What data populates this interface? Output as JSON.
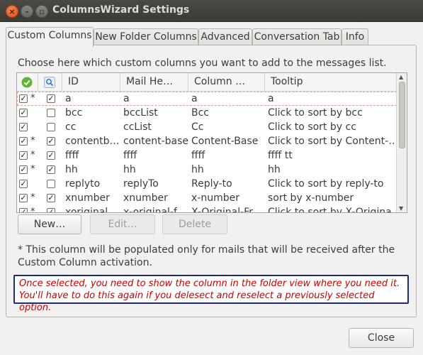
{
  "window": {
    "title": "ColumnsWizard Settings"
  },
  "tabs": [
    "Custom Columns",
    "New Folder Columns",
    "Advanced",
    "Conversation Tab",
    "Info"
  ],
  "intro": "Choose here which custom columns you want to add to the messages list.",
  "table": {
    "headers": {
      "enabled_icon": "check-circle-icon",
      "search_icon": "search-icon",
      "id": "ID",
      "mail_header": "Mail He…",
      "column": "Column …",
      "tooltip": "Tooltip"
    },
    "rows": [
      {
        "enabled": true,
        "star": "*",
        "search": true,
        "id": "a",
        "mail_header": "a",
        "column": "a",
        "tooltip": "a"
      },
      {
        "enabled": true,
        "star": "",
        "search": false,
        "id": "bcc",
        "mail_header": "bccList",
        "column": "Bcc",
        "tooltip": "Click to sort by bcc"
      },
      {
        "enabled": true,
        "star": "",
        "search": false,
        "id": "cc",
        "mail_header": "ccList",
        "column": "Cc",
        "tooltip": "Click to sort by cc"
      },
      {
        "enabled": true,
        "star": "*",
        "search": true,
        "id": "contentb…",
        "mail_header": "content-base",
        "column": "Content-Base",
        "tooltip": "Click to sort by Content-…"
      },
      {
        "enabled": true,
        "star": "*",
        "search": true,
        "id": "ffff",
        "mail_header": "ffff",
        "column": "ffff",
        "tooltip": "ffff tt"
      },
      {
        "enabled": true,
        "star": "*",
        "search": true,
        "id": "hh",
        "mail_header": "hh",
        "column": "hh",
        "tooltip": "hh"
      },
      {
        "enabled": true,
        "star": "",
        "search": false,
        "id": "replyto",
        "mail_header": "replyTo",
        "column": "Reply-to",
        "tooltip": "Click to sort by reply-to"
      },
      {
        "enabled": true,
        "star": "*",
        "search": true,
        "id": "xnumber",
        "mail_header": "xnumber",
        "column": "x-number",
        "tooltip": "sort by x-number"
      },
      {
        "enabled": true,
        "star": "*",
        "search": true,
        "id": "xoriginal…",
        "mail_header": "x-original-f…",
        "column": "X-Original-Fr…",
        "tooltip": "Click to sort by X-Origina…"
      }
    ]
  },
  "buttons": {
    "new": "New…",
    "edit": "Edit…",
    "delete": "Delete",
    "close": "Close"
  },
  "note": "* This column will be populated only for mails that will be received after the Custom Column activation.",
  "warning": "Once selected, you need to show the column in the folder view where you need it. You'll have to do this again if you delesect and reselect a previously selected option.",
  "colors": {
    "warning_text": "#cc0000",
    "warning_border": "#1e2a7a",
    "titlebar": "#3b3a36"
  }
}
